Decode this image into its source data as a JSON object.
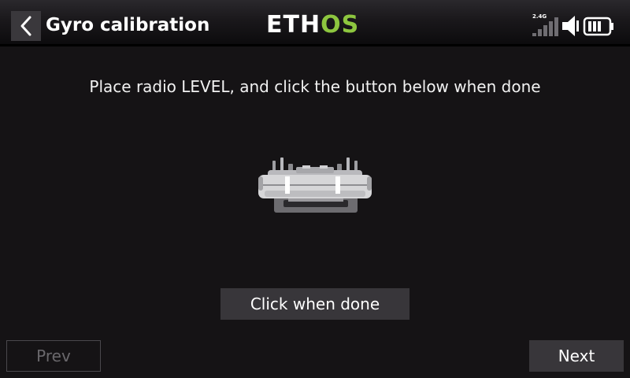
{
  "header": {
    "title": "Gyro calibration",
    "logo_main": "ETH",
    "logo_accent": "OS",
    "back_icon": "chevron-left-icon",
    "status": {
      "band_label": "2.4G",
      "icons": [
        "signal-bars-icon",
        "volume-icon",
        "battery-icon"
      ]
    }
  },
  "main": {
    "instruction": "Place radio LEVEL, and click the button below when done",
    "illustration_icon": "radio-transmitter-icon",
    "done_button_label": "Click when done"
  },
  "footer": {
    "prev_label": "Prev",
    "prev_enabled": false,
    "next_label": "Next"
  },
  "colors": {
    "background": "#151315",
    "button": "#38363a",
    "accent": "#8dc63f",
    "disabled_text": "#6a686c"
  }
}
